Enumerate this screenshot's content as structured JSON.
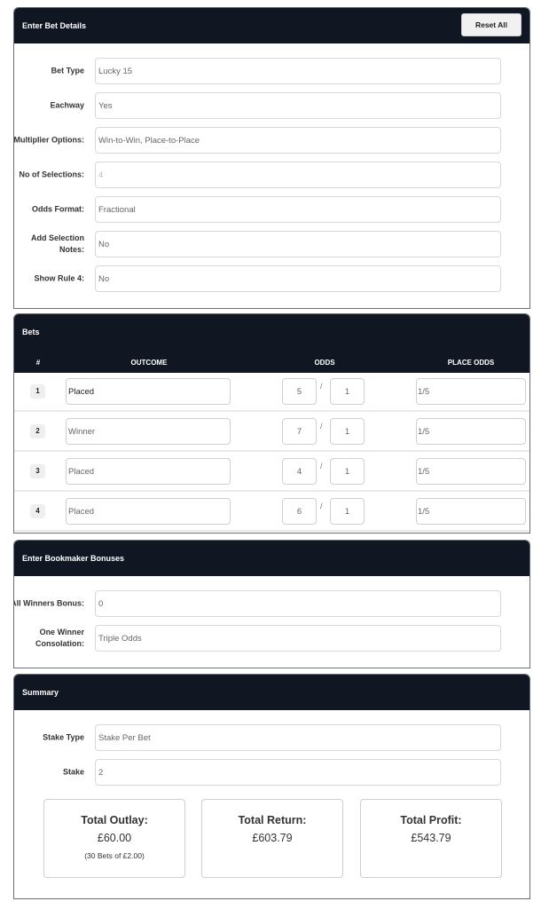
{
  "bet_details": {
    "title": "Enter Bet Details",
    "reset_label": "Reset All",
    "fields": [
      {
        "label": "Bet Type",
        "value": "Lucky 15"
      },
      {
        "label": "Eachway",
        "value": "Yes"
      },
      {
        "label": "Multiplier Options:",
        "value": "Win-to-Win, Place-to-Place"
      },
      {
        "label": "No of Selections:",
        "value": "4"
      },
      {
        "label": "Odds Format:",
        "value": "Fractional"
      },
      {
        "label": "Add Selection Notes:",
        "value": "No"
      },
      {
        "label": "Show Rule 4:",
        "value": "No"
      }
    ]
  },
  "bets": {
    "title": "Bets",
    "columns": {
      "num": "#",
      "outcome": "OUTCOME",
      "odds": "ODDS",
      "place_odds": "PLACE ODDS"
    },
    "slash": "/",
    "rows": [
      {
        "num": "1",
        "outcome": "Placed",
        "odds_num": "5",
        "odds_den": "1",
        "place_odds": "1/5"
      },
      {
        "num": "2",
        "outcome": "Winner",
        "odds_num": "7",
        "odds_den": "1",
        "place_odds": "1/5"
      },
      {
        "num": "3",
        "outcome": "Placed",
        "odds_num": "4",
        "odds_den": "1",
        "place_odds": "1/5"
      },
      {
        "num": "4",
        "outcome": "Placed",
        "odds_num": "6",
        "odds_den": "1",
        "place_odds": "1/5"
      }
    ]
  },
  "bonuses": {
    "title": "Enter Bookmaker Bonuses",
    "fields": [
      {
        "label": "All Winners Bonus:",
        "value": "0"
      },
      {
        "label": "One Winner Consolation:",
        "value": "Triple Odds"
      }
    ]
  },
  "summary": {
    "title": "Summary",
    "fields": [
      {
        "label": "Stake Type",
        "value": "Stake Per Bet"
      },
      {
        "label": "Stake",
        "value": "2"
      }
    ],
    "totals": {
      "outlay_label": "Total Outlay:",
      "outlay_value": "£60.00",
      "outlay_sub": "(30 Bets of £2.00)",
      "return_label": "Total Return:",
      "return_value": "£603.79",
      "profit_label": "Total Profit:",
      "profit_value": "£543.79"
    }
  }
}
